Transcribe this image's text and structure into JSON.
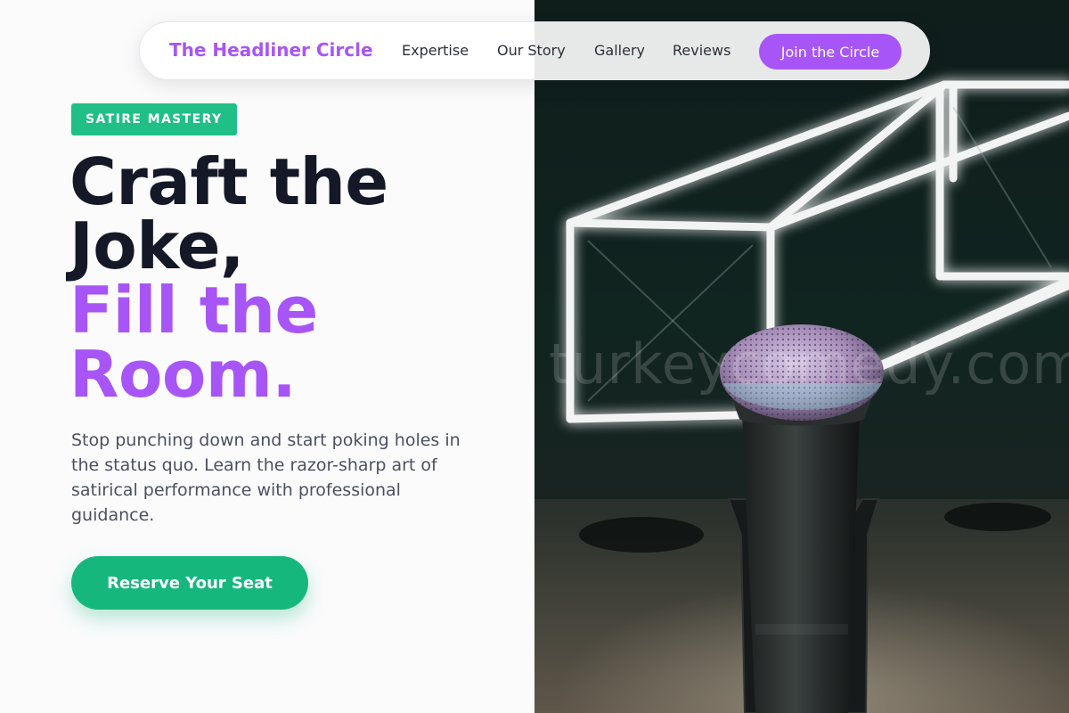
{
  "nav": {
    "brand": "The Headliner Circle",
    "links": [
      "Expertise",
      "Our Story",
      "Gallery",
      "Reviews"
    ],
    "cta": "Join the Circle"
  },
  "hero": {
    "badge": "SATIRE MASTERY",
    "headline_dark": [
      "Craft the",
      "Joke,"
    ],
    "headline_accent": [
      "Fill the",
      "Room."
    ],
    "lede": "Stop punching down and start poking holes in the status quo. Learn the razor-sharp art of satirical performance with professional guidance.",
    "cta": "Reserve Your Seat"
  },
  "image": {
    "watermark": "turkeycomedy.com",
    "subject": "microphone in front of neon light-tube cube on dark stage"
  },
  "colors": {
    "accent_purple": "#a855f7",
    "accent_green": "#16b77d",
    "headline_dark": "#141827"
  }
}
